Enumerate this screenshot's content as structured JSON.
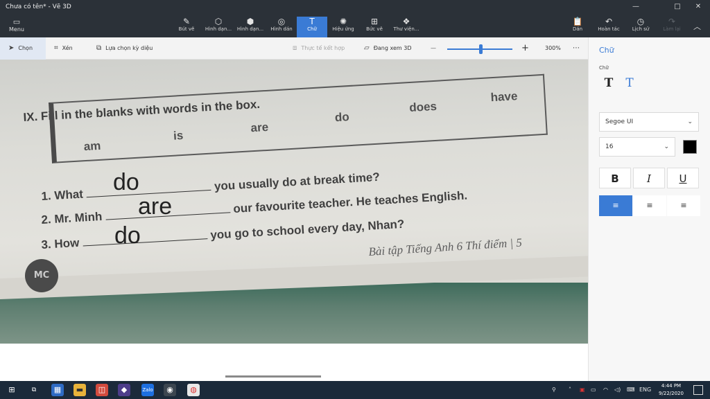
{
  "window": {
    "title": "Chưa có tên* - Vẽ 3D",
    "minimize_icon": "—",
    "maximize_icon": "□",
    "close_icon": "✕"
  },
  "ribbon": {
    "menu": {
      "label": "Menu",
      "icon": "folder-icon"
    },
    "tools": [
      {
        "label": "Bút vẽ",
        "icon": "brush-icon"
      },
      {
        "label": "Hình dạn...",
        "icon": "2d-shapes-icon"
      },
      {
        "label": "Hình dạn...",
        "icon": "3d-shapes-icon"
      },
      {
        "label": "Hình dán",
        "icon": "stickers-icon"
      },
      {
        "label": "Chữ",
        "icon": "text-icon",
        "active": true
      },
      {
        "label": "Hiệu ứng",
        "icon": "effects-icon"
      },
      {
        "label": "Bức vẽ",
        "icon": "canvas-icon"
      },
      {
        "label": "Thư viện...",
        "icon": "library-icon"
      }
    ],
    "right_tools": [
      {
        "label": "Dán",
        "icon": "paste-icon"
      },
      {
        "label": "Hoàn tác",
        "icon": "undo-icon"
      },
      {
        "label": "Lịch sử",
        "icon": "history-icon"
      },
      {
        "label": "Làm lại",
        "icon": "redo-icon",
        "disabled": true
      }
    ]
  },
  "toolbar": {
    "select": "Chọn",
    "crop": "Xén",
    "magic_select": "Lựa chọn kỳ diệu",
    "mixed_reality": "Thực tế kết hợp",
    "view_3d": "Đang xem 3D",
    "zoom_minus": "—",
    "zoom_plus": "+",
    "zoom_level": 300,
    "zoom_label": "300%",
    "zoom_slider_fraction": 0.51,
    "more": "⋯"
  },
  "photo": {
    "exercise_title": "IX. Fill in the blanks with words in the box.",
    "word_box": [
      "am",
      "is",
      "are",
      "do",
      "does",
      "have"
    ],
    "sentences": [
      {
        "number": "1. What",
        "rest": "you usually do at break time?",
        "answer": "do"
      },
      {
        "number": "2. Mr. Minh",
        "rest": "our favourite teacher. He teaches English.",
        "answer": "are"
      },
      {
        "number": "3. How",
        "rest": "you go to school every day, Nhan?",
        "answer": "do"
      }
    ],
    "credit": "Bài tập Tiếng Anh 6 Thí điểm | 5",
    "logo_text": "MC"
  },
  "panel": {
    "title": "Chữ",
    "subtitle": "Chữ",
    "font_family": "Segoe UI",
    "font_size": "16",
    "text_color": "#000000",
    "bold": "B",
    "italic": "I",
    "underline": "U",
    "align_left": "≡",
    "align_center": "≡",
    "align_right": "≡"
  },
  "taskbar": {
    "start": "⊞",
    "tray_lang": "ENG",
    "time": "4:44 PM",
    "date": "9/22/2020"
  },
  "colors": {
    "accent": "#3a7bd5",
    "ribbon": "#2b3138",
    "taskbar": "#1b2a3a"
  }
}
